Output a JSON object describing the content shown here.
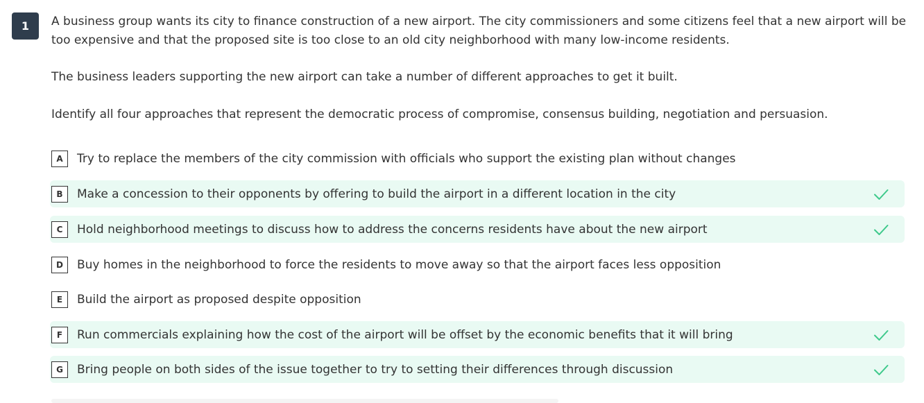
{
  "question": {
    "number": "1",
    "paragraphs": [
      "A business group wants its city to finance construction of a new airport. The city commissioners and some citizens feel that a new airport will be too expensive and that the proposed site is too close to an old city neighborhood with many low-income residents.",
      "The business leaders supporting the new airport can take a number of different approaches to get it built.",
      "Identify all four approaches that represent the democratic process of compromise, consensus building, negotiation and persuasion."
    ]
  },
  "choices": [
    {
      "letter": "A",
      "text": "Try to replace the members of the city commission with officials who support the existing plan without changes",
      "correct": false
    },
    {
      "letter": "B",
      "text": "Make a concession to their opponents by offering to build the airport in a different location in the city",
      "correct": true,
      "icon": "check-icon"
    },
    {
      "letter": "C",
      "text": "Hold neighborhood meetings to discuss how to address the concerns residents have about the new airport",
      "correct": true,
      "icon": "check-icon"
    },
    {
      "letter": "D",
      "text": "Buy homes in the neighborhood to force the residents to move away so that the airport faces less opposition",
      "correct": false
    },
    {
      "letter": "E",
      "text": "Build the airport as proposed despite opposition",
      "correct": false
    },
    {
      "letter": "F",
      "text": "Run commercials explaining how the cost of the airport will be offset by the economic benefits that it will bring",
      "correct": true,
      "icon": "check-icon"
    },
    {
      "letter": "G",
      "text": "Bring people on both sides of the issue together to try to setting their differences through discussion",
      "correct": true,
      "icon": "check-icon"
    }
  ],
  "colors": {
    "correct_background": "#e9faf3",
    "check": "#3ec98b",
    "number_badge": "#2f3d4d"
  }
}
